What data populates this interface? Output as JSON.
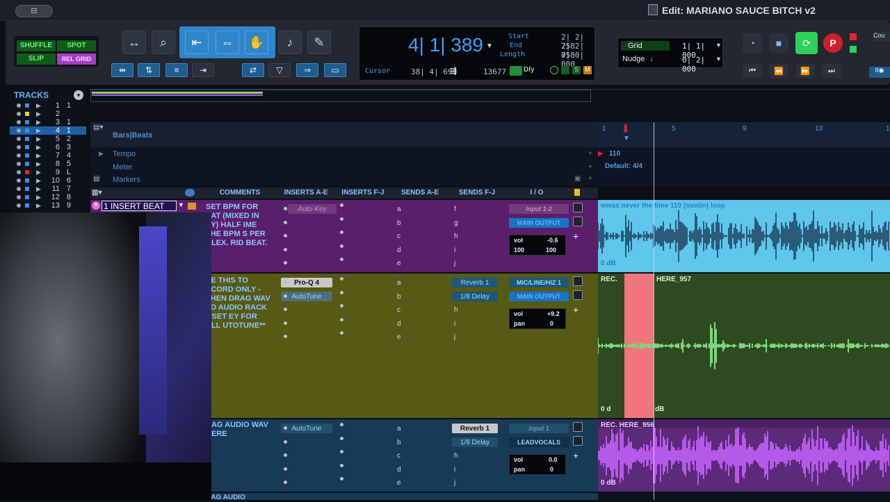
{
  "window": {
    "title": "Edit: MARIANO SAUCE BITCH v2",
    "pill": "⊟"
  },
  "modes": {
    "shuffle": "SHUFFLE",
    "spot": "SPOT",
    "slip": "SLIP",
    "grid": "REL GRID"
  },
  "counter": {
    "main": "4| 1| 389",
    "start_label": "Start",
    "start": "2| 2| 758",
    "end_label": "End",
    "end": "2| 2| 758",
    "length_label": "Length",
    "length": "0| 0| 000",
    "cursor_label": "Cursor",
    "cursor": "38| 4| 690",
    "sample": "13677",
    "dly": "Dly",
    "s": "S",
    "m": "M"
  },
  "grid": {
    "grid_label": "Grid",
    "grid_value": "1| 1| 000",
    "nudge_label": "Nudge",
    "nudge_value": "0| 2| 000"
  },
  "transport": {
    "cut_label": "Cou"
  },
  "tracks_panel": {
    "title": "TRACKS",
    "rows": [
      {
        "n": "1",
        "s": "1"
      },
      {
        "n": "2",
        "s": ""
      },
      {
        "n": "3",
        "s": "1"
      },
      {
        "n": "4",
        "s": "1"
      },
      {
        "n": "5",
        "s": "2"
      },
      {
        "n": "6",
        "s": "3"
      },
      {
        "n": "7",
        "s": "4"
      },
      {
        "n": "8",
        "s": "5"
      },
      {
        "n": "9",
        "s": "L"
      },
      {
        "n": "10",
        "s": "6"
      },
      {
        "n": "11",
        "s": "7"
      },
      {
        "n": "12",
        "s": "8"
      },
      {
        "n": "13",
        "s": "9"
      }
    ]
  },
  "rulers": {
    "bars": "Bars|Beats",
    "tempo": "Tempo",
    "meter": "Meter",
    "markers": "Markers",
    "tempo_value": "110",
    "meter_value": "Default: 4/4"
  },
  "timeline_ticks": [
    "1",
    "5",
    "9",
    "13",
    "1"
  ],
  "columns": {
    "comments": "COMMENTS",
    "ins_ae": "INSERTS A-E",
    "ins_fj": "INSERTS F-J",
    "sends_ae": "SENDS A-E",
    "sends_fj": "SENDS F-J",
    "io": "I / O"
  },
  "tracks": [
    {
      "name": "1 INSERT BEAT",
      "comment": "SET BPM FOR EAT (MIXED IN EY) HALF IME THE BPM S PER ALEX. RID BEAT.",
      "inserts": [
        "Auto-Key"
      ],
      "sends_fj": [
        "f",
        "g",
        "h",
        "i",
        "j"
      ],
      "input": "Input 1-2",
      "output": "MAIN OUTPUT",
      "vol_label": "vol",
      "vol": "-0.6",
      "pan_l": "100",
      "pan_r": "100",
      "clip": "wwas never the time 110 (sustin) loop",
      "db": "0 dB"
    },
    {
      "name": "",
      "comment": "SE THIS TO ECORD ONLY - THEN DRAG WAV TO AUDIO RACK **SET EY FOR ALL UTOTUNE**",
      "inserts": [
        "Pro-Q 4",
        "AutoTune"
      ],
      "sends_fj": [
        "Reverb 1",
        "1/8 Delay"
      ],
      "input": "MIC/LINE/HIZ 1",
      "output": "MAIN OUTPUT",
      "vol_label": "vol",
      "vol": "+9.2",
      "pan_label": "pan",
      "pan": "0",
      "clip_rec": "REC.",
      "clip": "HERE_957",
      "db": "0 d",
      "db2": "dB"
    },
    {
      "name": "",
      "comment": "RAG AUDIO WAV HERE",
      "inserts": [
        "AutoTune"
      ],
      "sends_fj": [
        "Reverb 1",
        "1/8 Delay"
      ],
      "input": "Input 1",
      "output": "LEADVOCALS",
      "vol_label": "vol",
      "vol": "0.0",
      "pan_label": "pan",
      "pan": "0",
      "clip": "REC. HERE_956",
      "db": "0 dB"
    },
    {
      "comment": "RAG AUDIO"
    }
  ],
  "send_letters_ae": [
    "a",
    "b",
    "c",
    "d",
    "e"
  ],
  "send_letters_fj": [
    "f",
    "g",
    "h",
    "i",
    "j"
  ],
  "colors": {
    "track1": "#5a1f6b",
    "track2": "#565a14",
    "track3": "#173a57",
    "wave1": "#5fc6ec",
    "wave2": "#7dd67a",
    "wave3": "#b45ae8",
    "rec": "#f0757d"
  }
}
